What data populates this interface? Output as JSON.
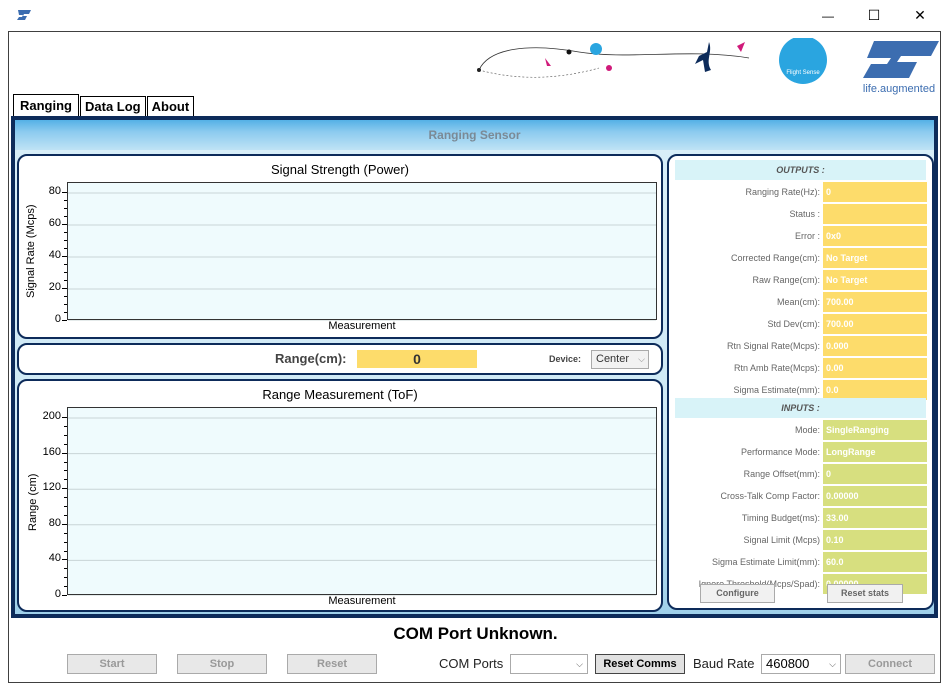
{
  "window": {
    "minimize_glyph": "—",
    "maximize_glyph": "☐",
    "close_glyph": "✕"
  },
  "header": {
    "brand_tagline": "life.augmented",
    "flight_sense": "Flight Sense"
  },
  "tabs": [
    {
      "label": "Ranging",
      "active": true
    },
    {
      "label": "Data Log",
      "active": false
    },
    {
      "label": "About",
      "active": false
    }
  ],
  "panel": {
    "title": "Ranging Sensor"
  },
  "chart_data": [
    {
      "type": "line",
      "title": "Signal Strength (Power)",
      "xlabel": "Measurement",
      "ylabel": "Signal Rate (Mcps)",
      "ylim": [
        0,
        80
      ],
      "yticks": [
        "0",
        "20",
        "40",
        "60",
        "80"
      ],
      "series": [],
      "grid": true
    },
    {
      "type": "line",
      "title": "Range Measurement (ToF)",
      "xlabel": "Measurement",
      "ylabel": "Range (cm)",
      "ylim": [
        0,
        200
      ],
      "yticks": [
        "0",
        "40",
        "80",
        "120",
        "160",
        "200"
      ],
      "series": [],
      "grid": true
    }
  ],
  "range_bar": {
    "label": "Range(cm):",
    "value": "0",
    "device_label": "Device:",
    "device_value": "Center"
  },
  "outputs": {
    "header": "OUTPUTS :",
    "fields": [
      {
        "label": "Ranging Rate(Hz):",
        "value": "0"
      },
      {
        "label": "Status :",
        "value": ""
      },
      {
        "label": "Error :",
        "value": "0x0"
      },
      {
        "label": "Corrected Range(cm):",
        "value": "No Target"
      },
      {
        "label": "Raw Range(cm):",
        "value": "No Target"
      },
      {
        "label": "Mean(cm):",
        "value": "700.00"
      },
      {
        "label": "Std Dev(cm):",
        "value": "700.00"
      },
      {
        "label": "Rtn Signal Rate(Mcps):",
        "value": "0.000"
      },
      {
        "label": "Rtn Amb Rate(Mcps):",
        "value": "0.00"
      },
      {
        "label": "Sigma Estimate(mm):",
        "value": "0.0"
      }
    ]
  },
  "inputs": {
    "header": "INPUTS :",
    "fields": [
      {
        "label": "Mode:",
        "value": "SingleRanging"
      },
      {
        "label": "Performance Mode:",
        "value": "LongRange"
      },
      {
        "label": "Range Offset(mm):",
        "value": "0"
      },
      {
        "label": "Cross-Talk Comp Factor:",
        "value": "0.00000"
      },
      {
        "label": "Timing Budget(ms):",
        "value": "33.00"
      },
      {
        "label": "Signal Limit (Mcps)",
        "value": "0.10"
      },
      {
        "label": "Sigma Estimate Limit(mm):",
        "value": "60.0"
      },
      {
        "label": "Ignore Threshold(Mcps/Spad):",
        "value": "0.00000"
      }
    ]
  },
  "panel_buttons": {
    "configure": "Configure",
    "reset_stats": "Reset stats"
  },
  "status": {
    "com_status": "COM Port Unknown."
  },
  "bottom": {
    "start": "Start",
    "stop": "Stop",
    "reset": "Reset",
    "com_ports_label": "COM Ports",
    "com_ports_value": "",
    "reset_comms": "Reset Comms",
    "baud_rate_label": "Baud Rate",
    "baud_rate_value": "460800",
    "connect": "Connect"
  },
  "colors": {
    "frame": "#0d2b5a",
    "output_value": "#fddc6b",
    "input_value": "#d7df7f",
    "plot_background": "#effbfd",
    "st_blue": "#3c6db0"
  }
}
